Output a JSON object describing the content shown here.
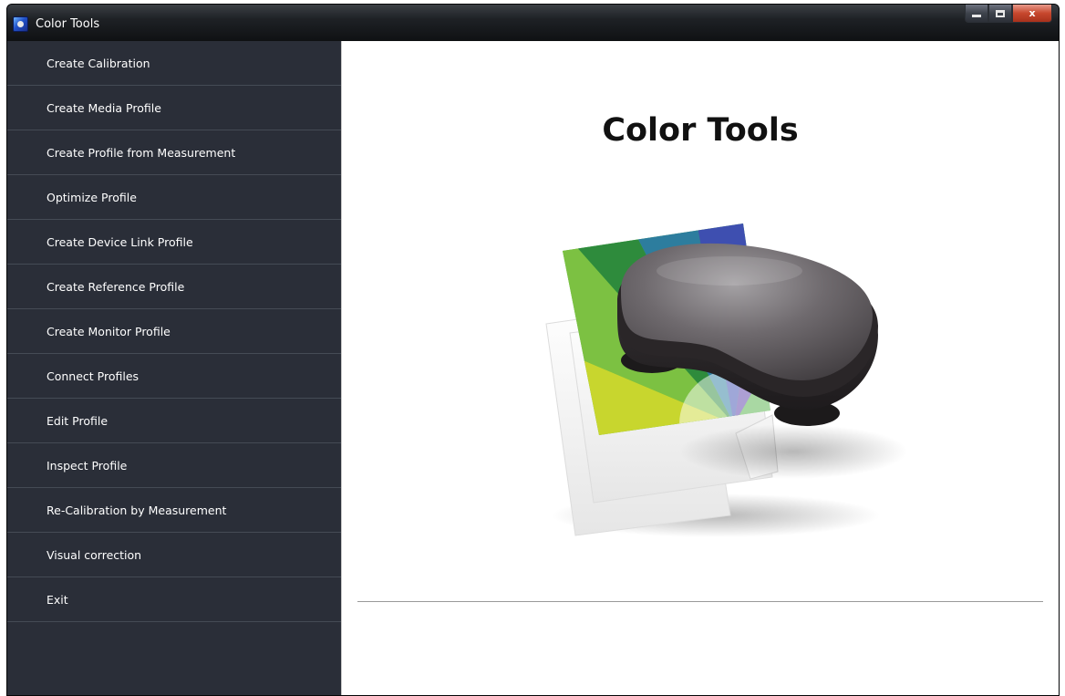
{
  "window": {
    "title": "Color Tools",
    "buttons": {
      "minimize": "minimize",
      "maximize": "maximize",
      "close": "x"
    }
  },
  "sidebar": {
    "items": [
      {
        "label": "Create Calibration"
      },
      {
        "label": "Create Media Profile"
      },
      {
        "label": "Create Profile from Measurement"
      },
      {
        "label": "Optimize Profile"
      },
      {
        "label": "Create Device Link Profile"
      },
      {
        "label": "Create Reference Profile"
      },
      {
        "label": "Create Monitor Profile"
      },
      {
        "label": "Connect Profiles"
      },
      {
        "label": "Edit Profile"
      },
      {
        "label": "Inspect Profile"
      },
      {
        "label": "Re-Calibration by Measurement"
      },
      {
        "label": "Visual correction"
      },
      {
        "label": "Exit"
      }
    ]
  },
  "main": {
    "title": "Color Tools",
    "illustration_icon": "spectrophotometer-on-color-wheel-icon"
  },
  "colors": {
    "sidebar_bg": "#2a2e38",
    "sidebar_divider": "#454b55",
    "content_bg": "#ffffff",
    "close_button": "#c7472d"
  }
}
